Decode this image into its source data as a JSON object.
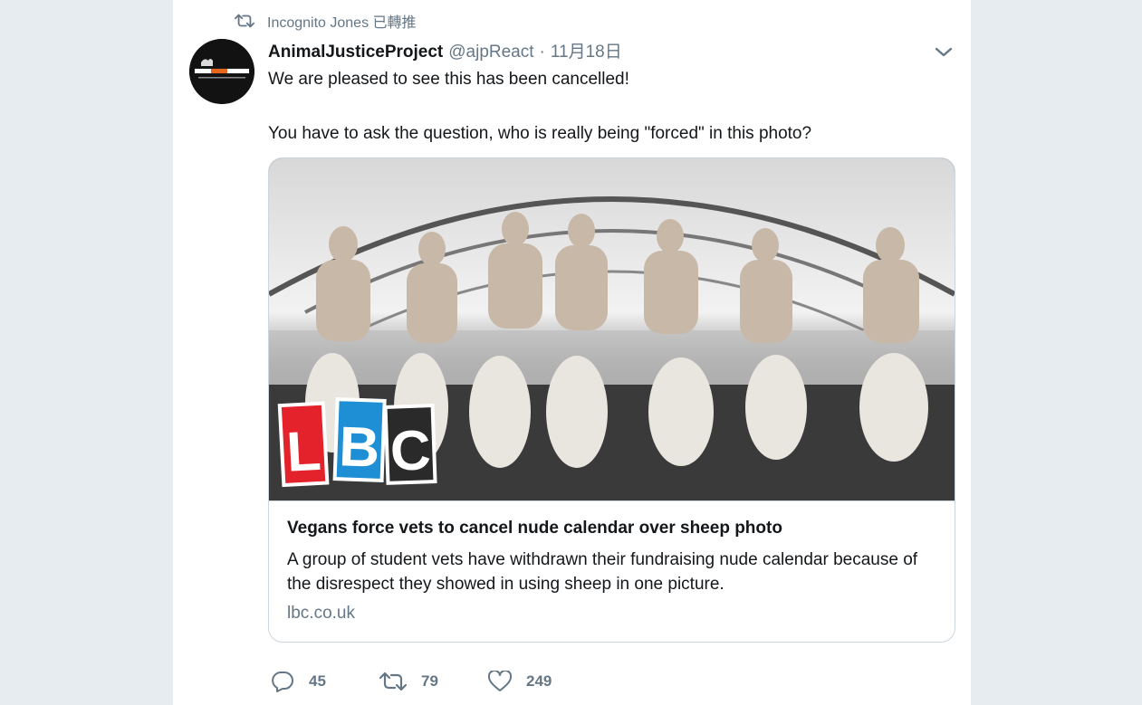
{
  "retweet_context": {
    "icon": "retweet-icon",
    "text": "Incognito Jones 已轉推"
  },
  "tweet": {
    "avatar_label": "ANIMAL JUSTICE PROJECT",
    "display_name": "AnimalJusticeProject",
    "handle": "@ajpReact",
    "separator": "·",
    "timestamp": "11月18日",
    "text": "We are pleased to see this has been cancelled!\n\nYou have to ask the question, who is really being \"forced\" in this photo?",
    "menu_icon": "chevron-down-icon"
  },
  "card": {
    "logo_letters": [
      "L",
      "B",
      "C"
    ],
    "logo_colors": [
      "#e3222b",
      "#1e8fd5",
      "#ffffff"
    ],
    "title": "Vegans force vets to cancel nude calendar over sheep photo",
    "description": "A group of student vets have withdrawn their fundraising nude calendar because of the disrespect they showed in using sheep in one picture.",
    "domain": "lbc.co.uk"
  },
  "actions": {
    "reply_count": "45",
    "retweet_count": "79",
    "like_count": "249"
  },
  "colors": {
    "background": "#e6ecf0",
    "secondary_text": "#657786",
    "primary_text": "#14171a",
    "border": "#ccd6dd"
  }
}
